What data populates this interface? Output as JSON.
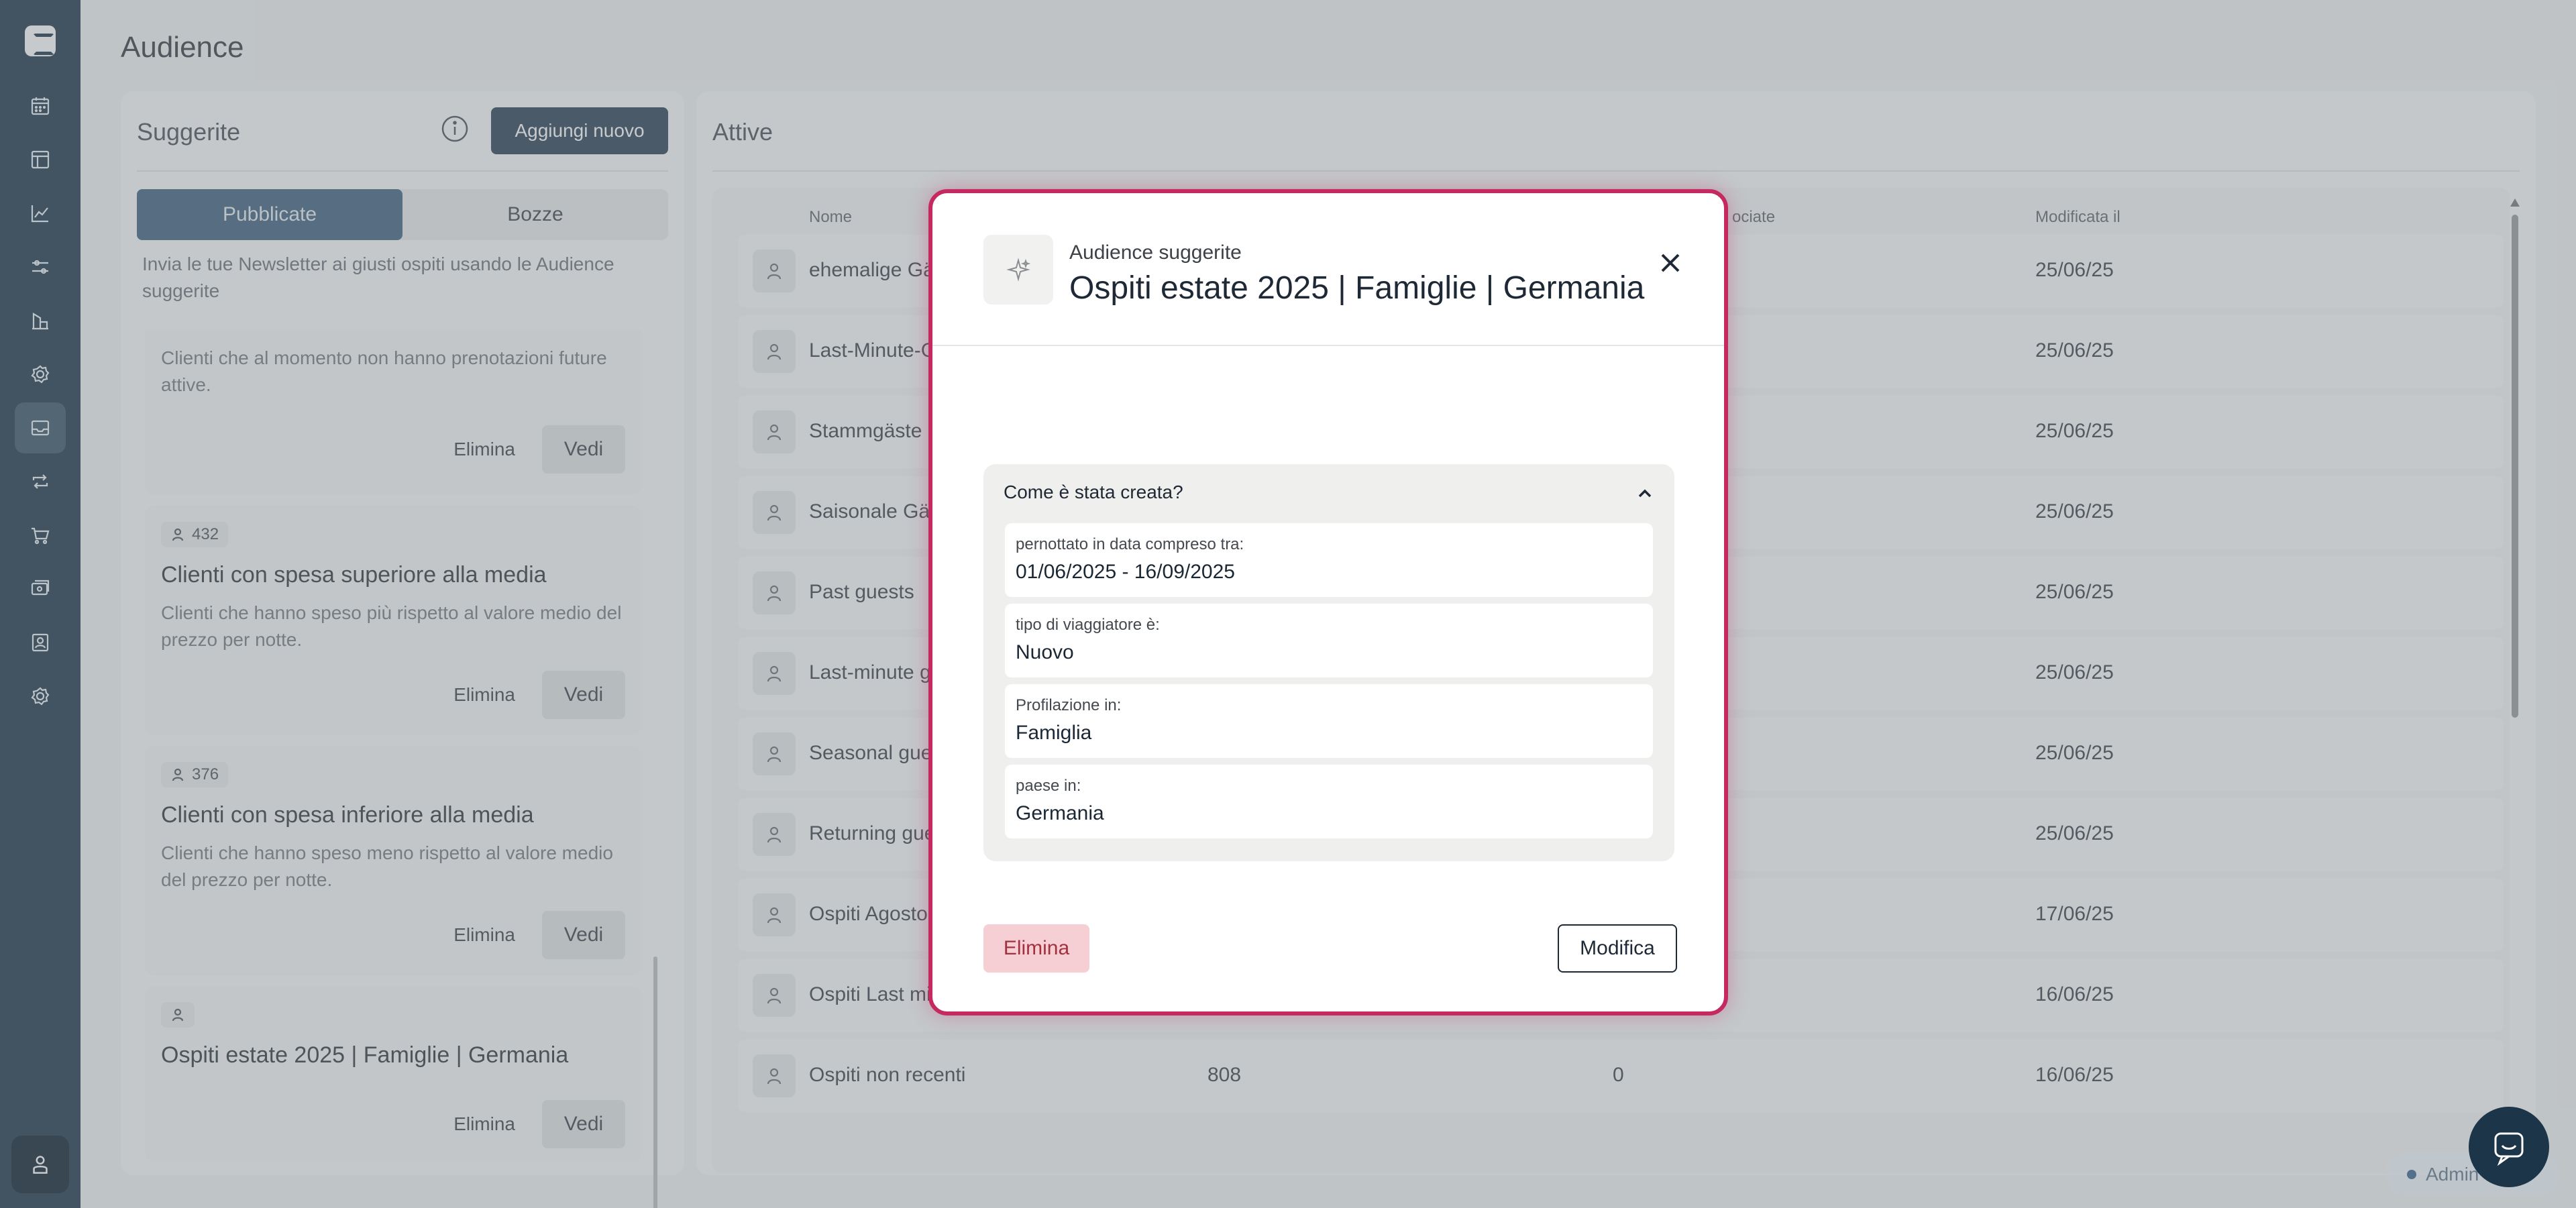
{
  "page": {
    "title": "Audience"
  },
  "left_panel": {
    "title": "Suggerite",
    "add_button": "Aggiungi nuovo",
    "tabs": [
      {
        "label": "Pubblicate",
        "active": true
      },
      {
        "label": "Bozze",
        "active": false
      }
    ],
    "description": "Invia le tue Newsletter ai giusti ospiti usando le Audience suggerite",
    "cards": [
      {
        "count": "",
        "title": "",
        "description": "Clienti che al momento non hanno prenotazioni future attive.",
        "delete": "Elimina",
        "view": "Vedi"
      },
      {
        "count": "432",
        "title": "Clienti con spesa superiore alla media",
        "description": "Clienti che hanno speso più rispetto al valore medio del prezzo per notte.",
        "delete": "Elimina",
        "view": "Vedi"
      },
      {
        "count": "376",
        "title": "Clienti con spesa inferiore alla media",
        "description": "Clienti che hanno speso meno rispetto al valore medio del prezzo per notte.",
        "delete": "Elimina",
        "view": "Vedi"
      },
      {
        "count": "",
        "title": "Ospiti estate 2025 | Famiglie | Germania",
        "description": "",
        "delete": "Elimina",
        "view": "Vedi"
      }
    ]
  },
  "right_panel": {
    "title": "Attive",
    "columns": {
      "name": "Nome",
      "associated": "ociate",
      "modified": "Modificata il"
    },
    "rows": [
      {
        "name": "ehemalige Gäs",
        "count": "",
        "assoc": "",
        "date": "25/06/25"
      },
      {
        "name": "Last-Minute-G",
        "count": "",
        "assoc": "",
        "date": "25/06/25"
      },
      {
        "name": "Stammgäste",
        "count": "",
        "assoc": "",
        "date": "25/06/25"
      },
      {
        "name": "Saisonale Gäs",
        "count": "",
        "assoc": "",
        "date": "25/06/25"
      },
      {
        "name": "Past guests",
        "count": "",
        "assoc": "",
        "date": "25/06/25"
      },
      {
        "name": "Last-minute gu",
        "count": "",
        "assoc": "",
        "date": "25/06/25"
      },
      {
        "name": "Seasonal gues",
        "count": "",
        "assoc": "",
        "date": "25/06/25"
      },
      {
        "name": "Returning gue",
        "count": "",
        "assoc": "",
        "date": "25/06/25"
      },
      {
        "name": "Ospiti Agosto",
        "count": "",
        "assoc": "",
        "date": "17/06/25"
      },
      {
        "name": "Ospiti Last mi",
        "count": "",
        "assoc": "",
        "date": "16/06/25"
      },
      {
        "name": "Ospiti non recenti",
        "count": "808",
        "assoc": "0",
        "date": "16/06/25"
      }
    ]
  },
  "modal": {
    "subtitle": "Audience suggerite",
    "title": "Ospiti estate 2025 | Famiglie | Germania",
    "accordion_title": "Come è stata creata?",
    "criteria": [
      {
        "label": "pernottato in data compreso tra:",
        "value": "01/06/2025 - 16/09/2025"
      },
      {
        "label": "tipo di viaggiatore è:",
        "value": "Nuovo"
      },
      {
        "label": "Profilazione in:",
        "value": "Famiglia"
      },
      {
        "label": "paese in:",
        "value": "Germania"
      }
    ],
    "delete_button": "Elimina",
    "edit_button": "Modifica"
  },
  "admin_pill": "Admin",
  "colors": {
    "sidebar": "#1d3548",
    "modal_border": "#c42a5f",
    "tab_active": "#41607c",
    "primary_button": "#2c3f51",
    "danger_bg": "#f5cfd3"
  },
  "icons": {
    "sidebar": [
      "logo-icon",
      "calendar-icon",
      "layout-icon",
      "chart-icon",
      "sliders-icon",
      "tower-icon",
      "settings-icon",
      "mail-icon",
      "repeat-icon",
      "cart-icon",
      "tickets-icon",
      "contact-icon",
      "gear-icon",
      "profile-icon"
    ]
  }
}
